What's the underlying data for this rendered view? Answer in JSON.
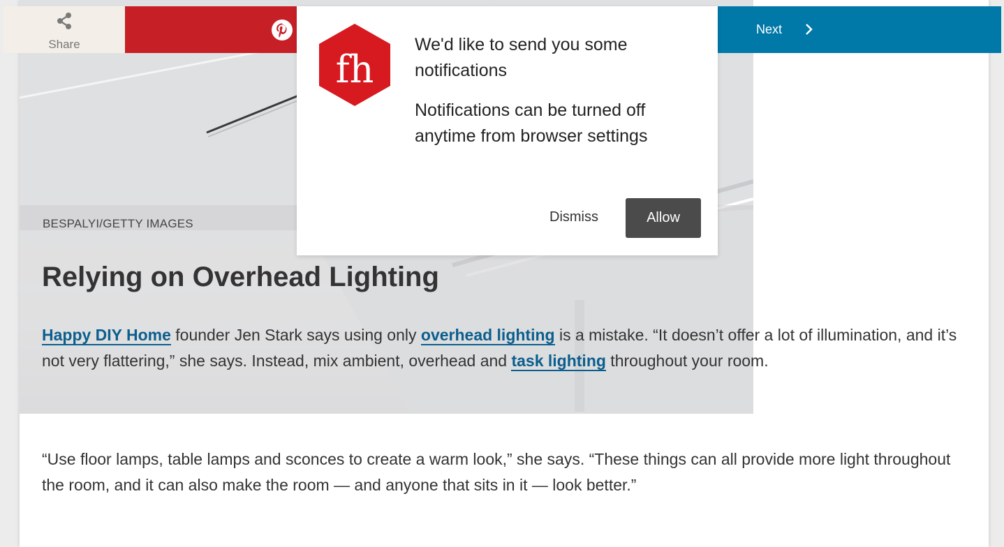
{
  "toolbar": {
    "share_label": "Share",
    "next_label": "Next",
    "share_bg": "#f3efe8",
    "pinterest_bg": "#c62026",
    "next_bg": "#0078a8"
  },
  "notification": {
    "logo_text": "fh",
    "title": "We'd like to send you some notifications",
    "body": "Notifications can be turned off anytime from browser settings",
    "dismiss_label": "Dismiss",
    "allow_label": "Allow",
    "logo_color": "#d71920"
  },
  "article": {
    "photo_credit": "BESPALYI/GETTY IMAGES",
    "heading": "Relying on Overhead Lighting",
    "para1": {
      "link1": "Happy DIY Home",
      "text1": " founder Jen Stark says using only ",
      "link2": "overhead lighting",
      "text2": " is a mistake. “It doesn’t offer a lot of illumination, and it’s not very flattering,” she says. Instead, mix ambient, overhead and ",
      "link3": "task lighting",
      "text3": " throughout your room."
    },
    "para2": "“Use floor lamps, table lamps and sconces to create a warm look,” she says. “These things can all provide more light throughout the room, and it can also make the room — and anyone that sits in it — look better.”",
    "link_color": "#0b5e8e"
  }
}
